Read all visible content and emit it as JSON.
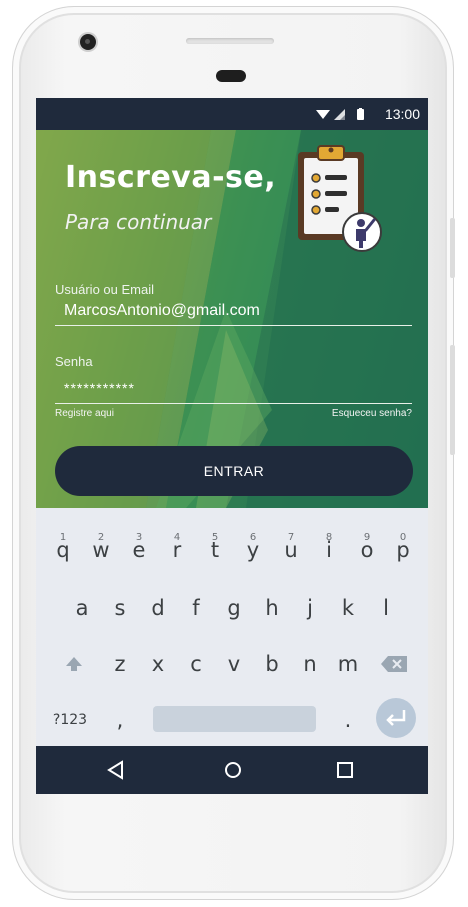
{
  "status_bar": {
    "time": "13:00",
    "icons": [
      "wifi-icon",
      "signal-icon",
      "battery-icon"
    ]
  },
  "header": {
    "title": "Inscreva-se,",
    "subtitle": "Para continuar"
  },
  "form": {
    "username_label": "Usuário ou Email",
    "username_value": "MarcosAntonio@gmail.com",
    "password_label": "Senha",
    "password_value": "***********",
    "register_link": "Registre aqui",
    "forgot_link": "Esqueceu senha?",
    "submit_label": "ENTRAR"
  },
  "keyboard": {
    "row1": [
      {
        "key": "q",
        "hint": "1"
      },
      {
        "key": "w",
        "hint": "2"
      },
      {
        "key": "e",
        "hint": "3"
      },
      {
        "key": "r",
        "hint": "4"
      },
      {
        "key": "t",
        "hint": "5"
      },
      {
        "key": "y",
        "hint": "6"
      },
      {
        "key": "u",
        "hint": "7"
      },
      {
        "key": "i",
        "hint": "8"
      },
      {
        "key": "o",
        "hint": "9"
      },
      {
        "key": "p",
        "hint": "0"
      }
    ],
    "row2": [
      "a",
      "s",
      "d",
      "f",
      "g",
      "h",
      "j",
      "k",
      "l"
    ],
    "row3": [
      "z",
      "x",
      "c",
      "v",
      "b",
      "n",
      "m"
    ],
    "symbols_key": "?123",
    "comma_key": ",",
    "period_key": "."
  },
  "colors": {
    "dark_navy": "#1f2a3c",
    "green_dark": "#257352",
    "green_light": "#7aa14a",
    "keyboard_bg": "#e8ebf1"
  }
}
